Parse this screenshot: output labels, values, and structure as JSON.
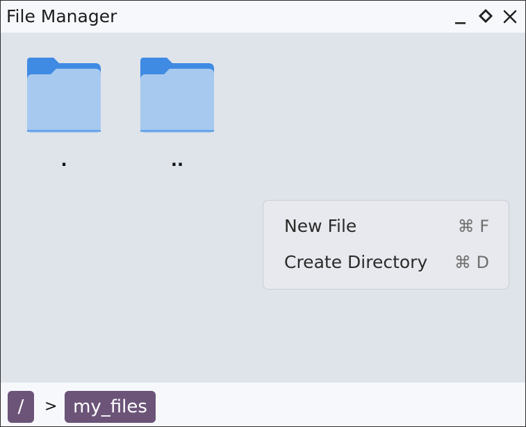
{
  "window": {
    "title": "File Manager",
    "controls": [
      "minimize-icon",
      "maximize-icon",
      "close-icon"
    ]
  },
  "files": [
    {
      "name": ".",
      "icon": "folder-icon"
    },
    {
      "name": "..",
      "icon": "folder-icon"
    }
  ],
  "context_menu": {
    "items": [
      {
        "label": "New File",
        "shortcut": "⌘ F"
      },
      {
        "label": "Create Directory",
        "shortcut": "⌘ D"
      }
    ]
  },
  "breadcrumb": {
    "segments": [
      "/",
      "my_files"
    ],
    "separator": ">"
  },
  "colors": {
    "content_bg": "#dfe3ea",
    "bar_bg": "#f7f8fc",
    "crumb_bg": "#6b5478",
    "folder_back": "#3f8be3",
    "folder_front": "#a7c9ef"
  }
}
